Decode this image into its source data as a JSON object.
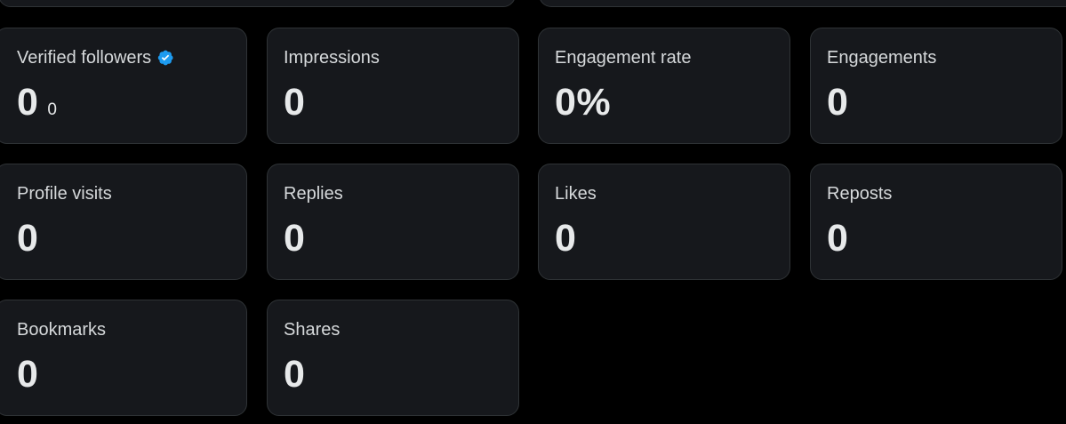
{
  "colors": {
    "background": "#000000",
    "card_background": "#16181c",
    "card_border": "#2f3336",
    "label_text": "#d6d9db",
    "value_text": "#e7e9ea",
    "verified_badge": "#1d9bf0"
  },
  "metrics": {
    "verified_followers": {
      "label": "Verified followers",
      "value": "0",
      "sub_value": "0",
      "icon": "verified-badge-icon"
    },
    "impressions": {
      "label": "Impressions",
      "value": "0"
    },
    "engagement_rate": {
      "label": "Engagement rate",
      "value": "0%"
    },
    "engagements": {
      "label": "Engagements",
      "value": "0"
    },
    "profile_visits": {
      "label": "Profile visits",
      "value": "0"
    },
    "replies": {
      "label": "Replies",
      "value": "0"
    },
    "likes": {
      "label": "Likes",
      "value": "0"
    },
    "reposts": {
      "label": "Reposts",
      "value": "0"
    },
    "bookmarks": {
      "label": "Bookmarks",
      "value": "0"
    },
    "shares": {
      "label": "Shares",
      "value": "0"
    }
  }
}
